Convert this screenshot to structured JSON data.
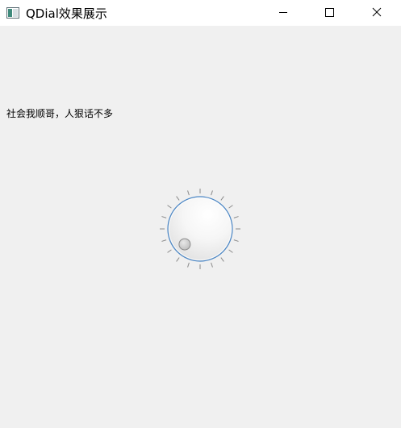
{
  "window": {
    "title": "QDial效果展示",
    "icons": {
      "app": "app-window-icon",
      "minimize": "minimize-icon",
      "maximize": "maximize-icon",
      "close": "close-icon"
    }
  },
  "main": {
    "label_text": "社会我顺哥，人狠话不多"
  },
  "dial": {
    "min": 0,
    "max": 99,
    "value": 0,
    "notches_visible": true,
    "accent_color": "#3b7fd6"
  }
}
